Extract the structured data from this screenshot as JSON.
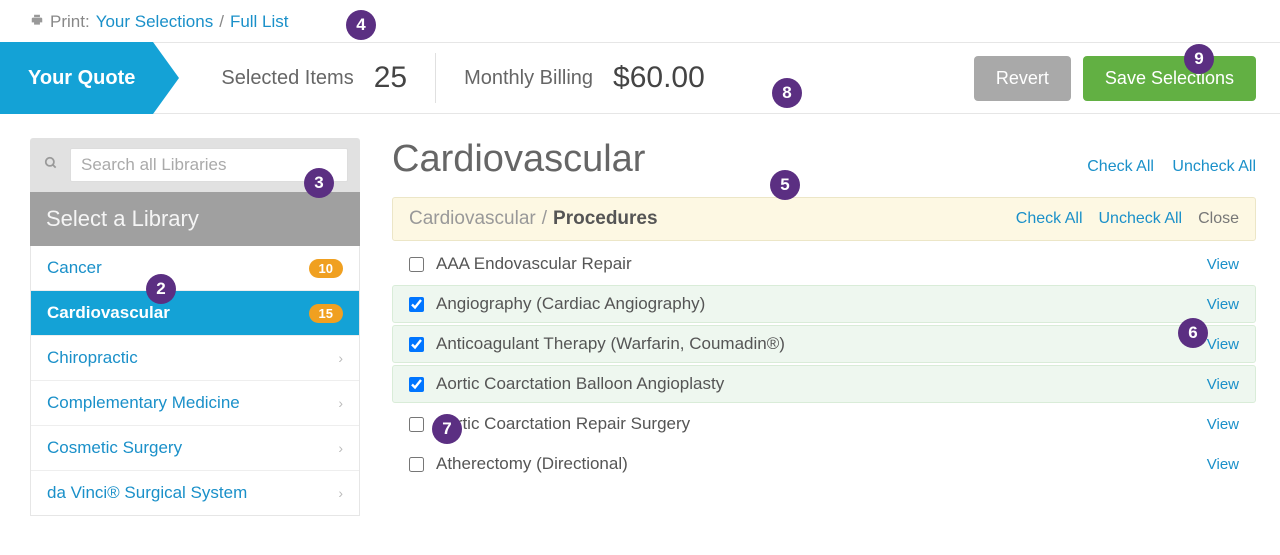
{
  "print": {
    "label": "Print:",
    "link1": "Your Selections",
    "link2": "Full List"
  },
  "quote": {
    "tab": "Your Quote",
    "selected_label": "Selected Items",
    "selected_value": "25",
    "billing_label": "Monthly Billing",
    "billing_value": "$60.00",
    "revert": "Revert",
    "save": "Save Selections"
  },
  "sidebar": {
    "search_placeholder": "Search all Libraries",
    "header": "Select a Library",
    "items": [
      {
        "name": "Cancer",
        "badge": "10",
        "active": false
      },
      {
        "name": "Cardiovascular",
        "badge": "15",
        "active": true
      },
      {
        "name": "Chiropractic",
        "badge": null,
        "active": false
      },
      {
        "name": "Complementary Medicine",
        "badge": null,
        "active": false
      },
      {
        "name": "Cosmetic Surgery",
        "badge": null,
        "active": false
      },
      {
        "name": "da Vinci® Surgical System",
        "badge": null,
        "active": false
      }
    ]
  },
  "content": {
    "title": "Cardiovascular",
    "check_all": "Check All",
    "uncheck_all": "Uncheck All",
    "section_parent": "Cardiovascular",
    "section_child": "Procedures",
    "close": "Close",
    "view": "View",
    "procedures": [
      {
        "label": "AAA Endovascular Repair",
        "checked": false
      },
      {
        "label": "Angiography (Cardiac Angiography)",
        "checked": true
      },
      {
        "label": "Anticoagulant Therapy (Warfarin, Coumadin®)",
        "checked": true
      },
      {
        "label": "Aortic Coarctation Balloon Angioplasty",
        "checked": true
      },
      {
        "label": "Aortic Coarctation Repair Surgery",
        "checked": false
      },
      {
        "label": "Atherectomy (Directional)",
        "checked": false
      }
    ]
  },
  "annotations": {
    "2": "2",
    "3": "3",
    "4": "4",
    "5": "5",
    "6": "6",
    "7": "7",
    "8": "8",
    "9": "9"
  }
}
